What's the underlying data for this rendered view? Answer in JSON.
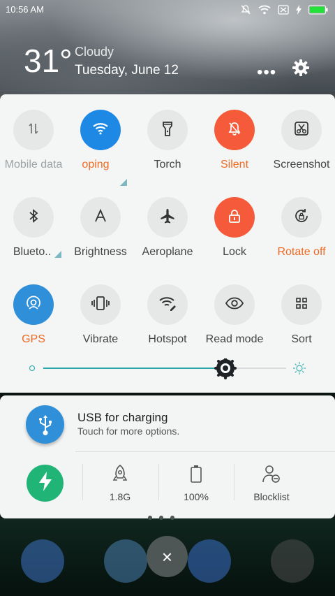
{
  "status_bar": {
    "time": "10:56 AM"
  },
  "weather": {
    "temperature": "31°",
    "condition": "Cloudy",
    "date": "Tuesday, June 12"
  },
  "header": {
    "more_label": "•••"
  },
  "quick_settings": {
    "rows": [
      [
        {
          "label": "Mobile data",
          "state": "off",
          "icon": "mobile-data-icon"
        },
        {
          "label": "oping",
          "state": "on",
          "icon": "wifi-icon",
          "expandable": true
        },
        {
          "label": "Torch",
          "state": "off",
          "icon": "torch-icon"
        },
        {
          "label": "Silent",
          "state": "on",
          "icon": "silent-bell-icon"
        },
        {
          "label": "Screenshot",
          "state": "off",
          "icon": "scissors-icon"
        }
      ],
      [
        {
          "label": "Blueto..",
          "state": "off",
          "icon": "bluetooth-icon",
          "expandable": true
        },
        {
          "label": "Brightness",
          "state": "off",
          "icon": "brightness-a-icon"
        },
        {
          "label": "Aeroplane",
          "state": "off",
          "icon": "aeroplane-icon"
        },
        {
          "label": "Lock",
          "state": "on",
          "icon": "lock-icon"
        },
        {
          "label": "Rotate off",
          "state": "on",
          "icon": "rotate-lock-icon"
        }
      ],
      [
        {
          "label": "GPS",
          "state": "on",
          "icon": "gps-icon"
        },
        {
          "label": "Vibrate",
          "state": "off",
          "icon": "vibrate-icon"
        },
        {
          "label": "Hotspot",
          "state": "off",
          "icon": "hotspot-icon"
        },
        {
          "label": "Read mode",
          "state": "off",
          "icon": "eye-icon"
        },
        {
          "label": "Sort",
          "state": "off",
          "icon": "grid-icon"
        }
      ]
    ],
    "brightness_level": 0.75
  },
  "notification": {
    "title": "USB for charging",
    "subtitle": "Touch for more options."
  },
  "tools": [
    {
      "label": "1.8G",
      "icon": "rocket-icon"
    },
    {
      "label": "100%",
      "icon": "battery-icon"
    },
    {
      "label": "Blocklist",
      "icon": "blocklist-icon"
    }
  ],
  "dock": {
    "close_label": "×"
  },
  "colors": {
    "accent_blue": "#1e88e5",
    "accent_orange": "#f55b3a",
    "label_orange": "#f06a22",
    "gps_blue": "#2f8fd8",
    "boost_green": "#21b477"
  }
}
